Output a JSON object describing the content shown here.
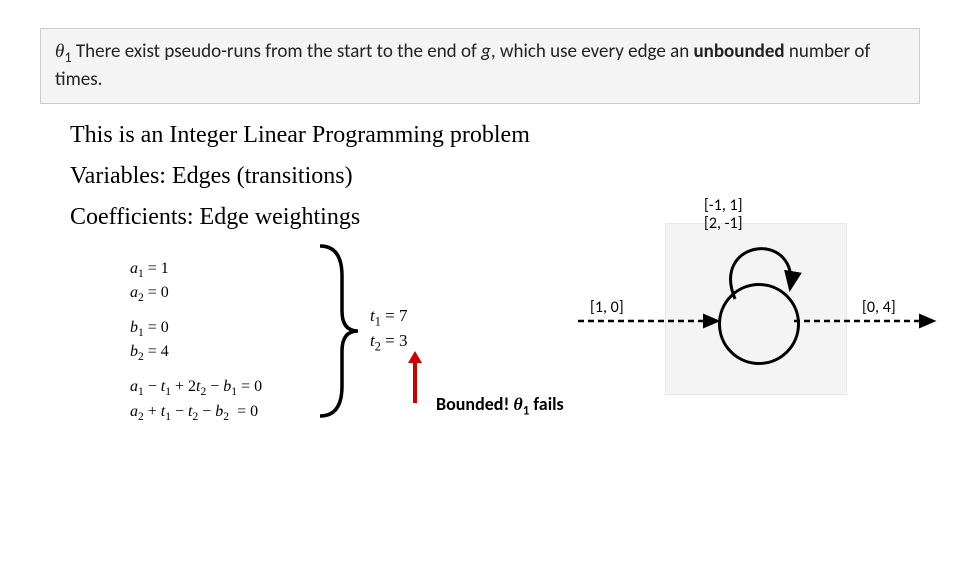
{
  "theta_statement": {
    "symbol": "θ",
    "subscript": "1",
    "text_before": "There exist pseudo-runs from the start to the end of",
    "g": "g",
    "text_after": ", which use every edge an",
    "bold_word": "unbounded",
    "tail": "number of times."
  },
  "lines": {
    "ilp": "This is an Integer Linear Programming problem",
    "vars": "Variables: Edges (transitions)",
    "coeffs": "Coefficients: Edge weightings"
  },
  "math": {
    "a1": "a",
    "a1sub": "1",
    "a1rhs": "= 1",
    "a2": "a",
    "a2sub": "2",
    "a2rhs": "= 0",
    "b1": "b",
    "b1sub": "1",
    "b1rhs": "= 0",
    "b2": "b",
    "b2sub": "2",
    "b2rhs": "= 4",
    "eq1_lhs_a": "a",
    "eq1_lhs_asub": "1",
    "eq1_lhs_t1": "t",
    "eq1_lhs_t1sub": "1",
    "eq1_lhs_t2": "t",
    "eq1_lhs_t2sub": "2",
    "eq1_lhs_b": "b",
    "eq1_lhs_bsub": "1",
    "eq2_lhs_a": "a",
    "eq2_lhs_asub": "2",
    "eq2_lhs_t1": "t",
    "eq2_lhs_t1sub": "1",
    "eq2_lhs_t2": "t",
    "eq2_lhs_t2sub": "2",
    "eq2_lhs_b": "b",
    "eq2_lhs_bsub": "2",
    "eq_rhs": "= 0"
  },
  "tvals": {
    "t1": "t",
    "t1sub": "1",
    "t1rhs": "= 7",
    "t2": "t",
    "t2sub": "2",
    "t2rhs": "= 3"
  },
  "fail": {
    "prefix": "Bounded! ",
    "theta": "θ",
    "sub": "1",
    "suffix": " fails"
  },
  "graph": {
    "loop_label_1": "[-1, 1]",
    "loop_label_2": "[2, -1]",
    "in_label": "[1, 0]",
    "out_label": "[0, 4]"
  }
}
